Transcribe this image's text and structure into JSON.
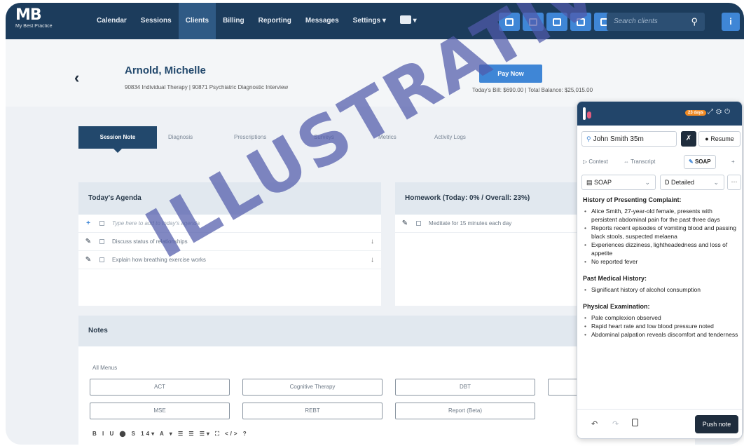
{
  "nav": {
    "logo_text": "MB",
    "logo_tagline": "My Best Practice",
    "links": [
      "Calendar",
      "Sessions",
      "Clients",
      "Billing",
      "Reporting",
      "Messages",
      "Settings ▾"
    ],
    "active_link": "Clients",
    "search_placeholder": "Search clients",
    "info_label": "i"
  },
  "client": {
    "name": "Arnold, Michelle",
    "services": "90834 Individual Therapy | 90871 Psychiatric Diagnostic Interview",
    "pay_now_label": "Pay Now",
    "bill_line": "Today's Bill: $690.00 | Total Balance: $25,015.00"
  },
  "tabs": [
    "Session Note",
    "Diagnosis",
    "Prescriptions",
    "Surveys",
    "Metrics",
    "Activity Logs"
  ],
  "agenda": {
    "title": "Today's Agenda",
    "placeholder": "Type here to add to today's agenda",
    "items": [
      "Discuss status of relationships",
      "Explain how breathing exercise works"
    ]
  },
  "homework": {
    "title": "Homework (Today: 0% / Overall: 23%)",
    "items": [
      "Meditate for 15 minutes each day"
    ]
  },
  "notes": {
    "title": "Notes",
    "menus_label": "All Menus",
    "buttons": [
      "ACT",
      "Cognitive Therapy",
      "DBT",
      "MSE",
      "REBT",
      "Report (Beta)"
    ],
    "toolbar": "B I U ⬤ S 14▾ A ▾ ☰ ☰ ☰▾ ⛶ </> ?"
  },
  "watermark": "ILLUSTRATIVE",
  "panel": {
    "days_badge": "23 days",
    "patient": "John Smith 35m",
    "resume_label": "Resume",
    "tabs": {
      "context": "Context",
      "transcript": "Transcript",
      "soap": "SOAP",
      "add": "+"
    },
    "template_select": "SOAP",
    "detail_select": "Detailed",
    "sections": [
      {
        "title": "History of Presenting Complaint:",
        "items": [
          "Alice Smith, 27-year-old female, presents with persistent abdominal pain for the past three days",
          "Reports recent episodes of vomiting blood and passing black stools, suspected melaena",
          "Experiences dizziness, lightheadedness and loss of appetite",
          "No reported fever"
        ]
      },
      {
        "title": "Past Medical History:",
        "items": [
          "Significant history of alcohol consumption"
        ]
      },
      {
        "title": "Physical Examination:",
        "items": [
          "Pale complexion observed",
          "Rapid heart rate and low blood pressure noted",
          "Abdominal palpation reveals discomfort and tenderness"
        ]
      }
    ],
    "push_note_label": "Push note"
  }
}
